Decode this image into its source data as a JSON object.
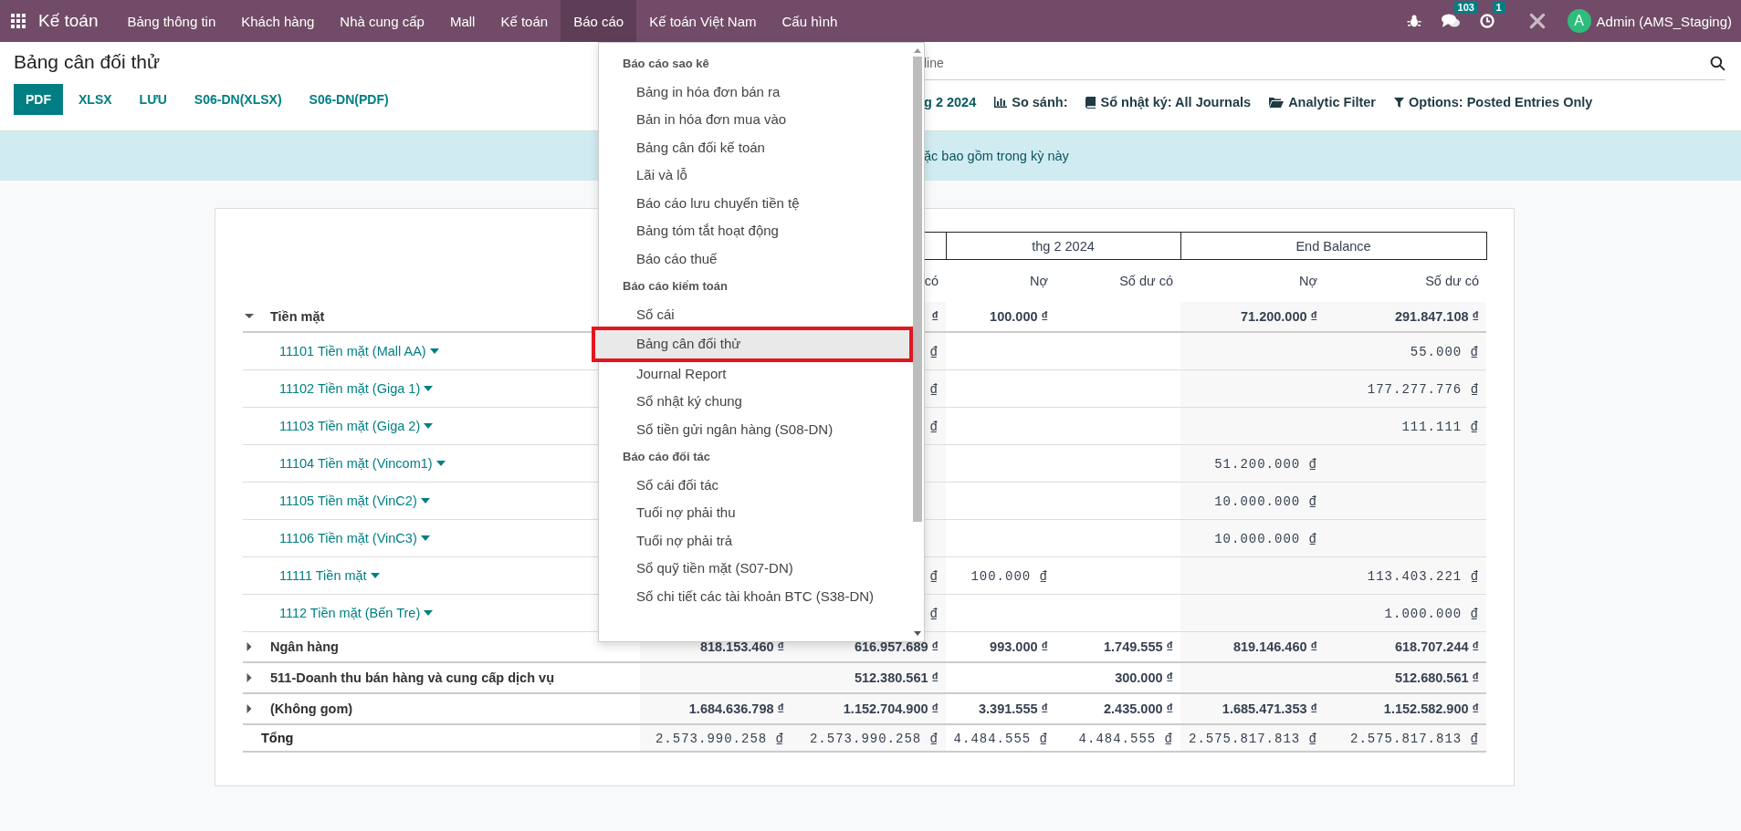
{
  "navbar": {
    "app_name": "Kế toán",
    "menu": [
      {
        "label": "Bảng thông tin",
        "selected": false
      },
      {
        "label": "Khách hàng",
        "selected": false
      },
      {
        "label": "Nhà cung cấp",
        "selected": false
      },
      {
        "label": "Mall",
        "selected": false
      },
      {
        "label": "Kế toán",
        "selected": false
      },
      {
        "label": "Báo cáo",
        "selected": true
      },
      {
        "label": "Kế toán Việt Nam",
        "selected": false
      },
      {
        "label": "Cấu hình",
        "selected": false
      }
    ],
    "messages_badge": "103",
    "activities_badge": "1",
    "avatar_letter": "A",
    "user": "Admin (AMS_Staging)"
  },
  "page": {
    "title": "Bảng cân đối thử",
    "buttons": [
      {
        "label": "PDF",
        "primary": true
      },
      {
        "label": "XLSX",
        "primary": false
      },
      {
        "label": "LƯU",
        "primary": false
      },
      {
        "label": "S06-DN(XLSX)",
        "primary": false
      },
      {
        "label": "S06-DN(PDF)",
        "primary": false
      }
    ],
    "search": {
      "placeholder": "line"
    },
    "filters": [
      {
        "kind": "date",
        "label": "g 2 2024"
      },
      {
        "kind": "compare",
        "label": "So sánh:"
      },
      {
        "kind": "journal",
        "label": "Sổ nhật ký: All Journals"
      },
      {
        "kind": "analytic",
        "label": "Analytic Filter"
      },
      {
        "kind": "options",
        "label": "Options: Posted Entries Only"
      }
    ],
    "alert": "ặc bao gồm trong kỳ này"
  },
  "dropdown": {
    "sections": [
      {
        "title": "Báo cáo sao kê",
        "items": [
          {
            "label": "Bảng in hóa đơn bán ra",
            "selected": false
          },
          {
            "label": "Bản in hóa đơn mua vào",
            "selected": false
          },
          {
            "label": "Bảng cân đối kế toán",
            "selected": false
          },
          {
            "label": "Lãi và lỗ",
            "selected": false
          },
          {
            "label": "Báo cáo lưu chuyển tiền tệ",
            "selected": false
          },
          {
            "label": "Bảng tóm tắt hoạt động",
            "selected": false
          },
          {
            "label": "Báo cáo thuế",
            "selected": false
          }
        ]
      },
      {
        "title": "Báo cáo kiểm toán",
        "items": [
          {
            "label": "Sổ cái",
            "selected": false
          },
          {
            "label": "Bảng cân đối thử",
            "selected": true
          },
          {
            "label": "Journal Report",
            "selected": false
          },
          {
            "label": "Sổ nhật ký chung",
            "selected": false
          },
          {
            "label": "Sổ tiền gửi ngân hàng (S08-DN)",
            "selected": false
          }
        ]
      },
      {
        "title": "Báo cáo đối tác",
        "items": [
          {
            "label": "Sổ cái đối tác",
            "selected": false
          },
          {
            "label": "Tuổi nợ phải thu",
            "selected": false
          },
          {
            "label": "Tuổi nợ phải trả",
            "selected": false
          },
          {
            "label": "Sổ quỹ tiền mặt (S07-DN)",
            "selected": false
          },
          {
            "label": "Sổ chi tiết các tài khoản BTC (S38-DN)",
            "selected": false
          }
        ]
      }
    ]
  },
  "table": {
    "column_groups": [
      "thg 2 2024",
      "End Balance"
    ],
    "columns": [
      "có",
      "Nợ",
      "Số dư có",
      "Nợ",
      "Số dư có"
    ],
    "rows": [
      {
        "kind": "group",
        "name": "Tiền mặt",
        "expanded": true,
        "cells": {
          "column_2": "₫",
          "column_3": "100.000 ₫",
          "column_5": "71.200.000 ₫",
          "column_6": "291.847.108 ₫"
        }
      },
      {
        "kind": "account",
        "name": "11101 Tiền mặt (Mall AA)",
        "cells": {
          "column_2": "₫",
          "column_6": "55.000 ₫"
        }
      },
      {
        "kind": "account",
        "name": "11102 Tiền mặt (Giga 1)",
        "cells": {
          "column_2": "₫",
          "column_6": "177.277.776 ₫"
        }
      },
      {
        "kind": "account",
        "name": "11103 Tiền mặt (Giga 2)",
        "cells": {
          "column_2": "₫",
          "column_6": "111.111 ₫"
        }
      },
      {
        "kind": "account",
        "name": "11104 Tiền mặt (Vincom1)",
        "cells": {
          "column_5": "51.200.000 ₫"
        }
      },
      {
        "kind": "account",
        "name": "11105 Tiền mặt (VinC2)",
        "cells": {
          "column_5": "10.000.000 ₫"
        }
      },
      {
        "kind": "account",
        "name": "11106 Tiền mặt (VinC3)",
        "cells": {
          "column_5": "10.000.000 ₫"
        }
      },
      {
        "kind": "account",
        "name": "11111 Tiền mặt",
        "cells": {
          "column_2": "₫",
          "column_3": "100.000 ₫",
          "column_6": "113.403.221 ₫"
        }
      },
      {
        "kind": "account",
        "name": "1112 Tiền mặt (Bến Tre)",
        "cells": {
          "column_2": "₫",
          "column_6": "1.000.000 ₫"
        }
      },
      {
        "kind": "group",
        "name": "Ngân hàng",
        "expanded": false,
        "cells": {
          "column_1": "818.153.460 ₫",
          "column_2": "616.957.689 ₫",
          "column_3": "993.000 ₫",
          "column_4": "1.749.555 ₫",
          "column_5": "819.146.460 ₫",
          "column_6": "618.707.244 ₫"
        }
      },
      {
        "kind": "group",
        "name": "511-Doanh thu bán hàng và cung cấp dịch vụ",
        "expanded": false,
        "cells": {
          "column_2": "512.380.561 ₫",
          "column_4": "300.000 ₫",
          "column_6": "512.680.561 ₫"
        }
      },
      {
        "kind": "group",
        "name": "(Không gom)",
        "expanded": false,
        "cells": {
          "column_1": "1.684.636.798 ₫",
          "column_2": "1.152.704.900 ₫",
          "column_3": "3.391.555 ₫",
          "column_4": "2.435.000 ₫",
          "column_5": "1.685.471.353 ₫",
          "column_6": "1.152.582.900 ₫"
        }
      },
      {
        "kind": "total",
        "name": "Tổng",
        "cells": {
          "column_1": "2.573.990.258 ₫",
          "column_2": "2.573.990.258 ₫",
          "column_3": "4.484.555 ₫",
          "column_4": "4.484.555 ₫",
          "column_5": "2.575.817.813 ₫",
          "column_6": "2.575.817.813 ₫"
        }
      }
    ]
  }
}
